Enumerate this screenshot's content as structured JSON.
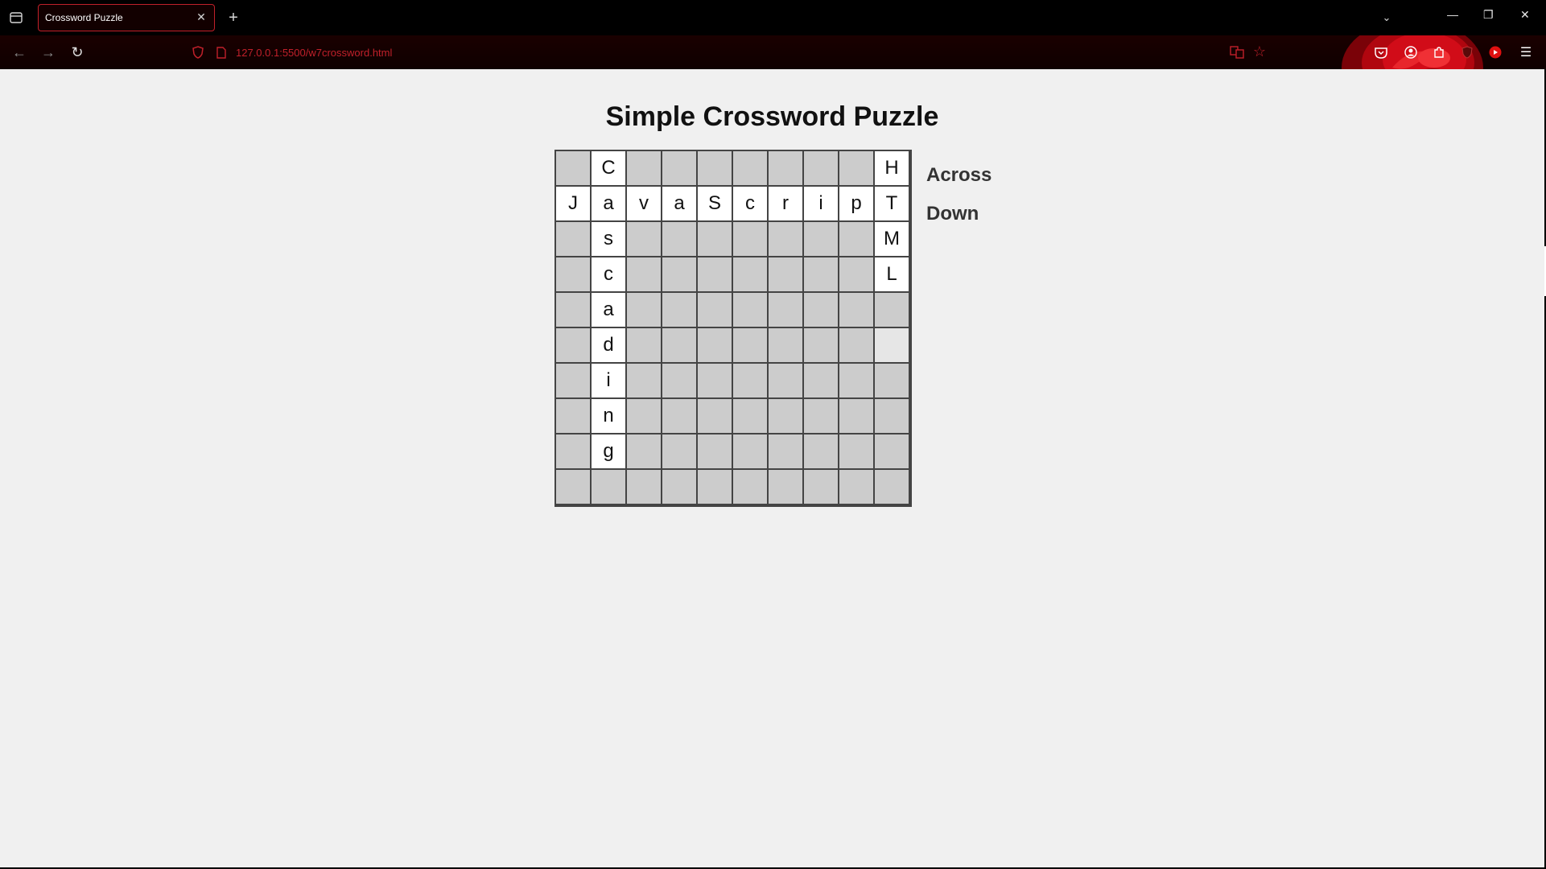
{
  "browser": {
    "tab": {
      "title": "Crossword Puzzle",
      "close_icon": "close-icon"
    },
    "url": "127.0.0.1:5500/w7crossword.html",
    "accent_color": "#c0202a"
  },
  "page": {
    "title": "Simple Crossword Puzzle",
    "clues": {
      "across_label": "Across",
      "down_label": "Down"
    },
    "grid": {
      "rows": [
        [
          "",
          "C",
          "",
          "",
          "",
          "",
          "",
          "",
          "",
          "H"
        ],
        [
          "J",
          "a",
          "v",
          "a",
          "S",
          "c",
          "r",
          "i",
          "p",
          "T"
        ],
        [
          "",
          "s",
          "",
          "",
          "",
          "",
          "",
          "",
          "",
          "M"
        ],
        [
          "",
          "c",
          "",
          "",
          "",
          "",
          "",
          "",
          "",
          "L"
        ],
        [
          "",
          "a",
          "",
          "",
          "",
          "",
          "",
          "",
          "",
          ""
        ],
        [
          "",
          "d",
          "",
          "",
          "",
          "",
          "",
          "",
          "",
          ""
        ],
        [
          "",
          "i",
          "",
          "",
          "",
          "",
          "",
          "",
          "",
          ""
        ],
        [
          "",
          "n",
          "",
          "",
          "",
          "",
          "",
          "",
          "",
          ""
        ],
        [
          "",
          "g",
          "",
          "",
          "",
          "",
          "",
          "",
          "",
          ""
        ],
        [
          "",
          "",
          "",
          "",
          "",
          "",
          "",
          "",
          "",
          ""
        ]
      ],
      "open_color": "#ffffff",
      "blocked_color": "#cccccc"
    }
  }
}
